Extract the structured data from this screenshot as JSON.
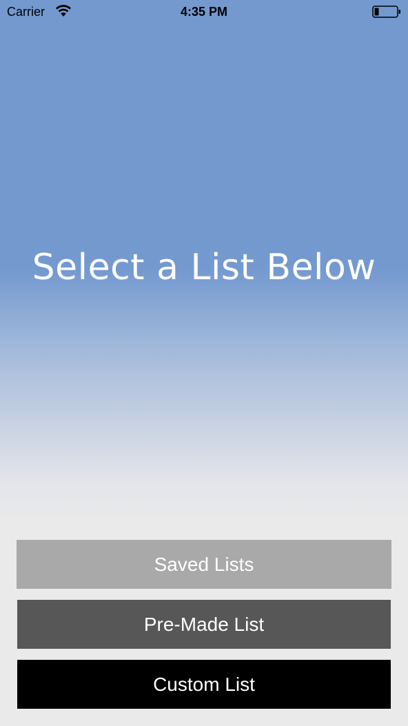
{
  "status_bar": {
    "carrier": "Carrier",
    "time": "4:35 PM",
    "wifi_icon": "wifi-icon",
    "battery_icon": "battery-icon"
  },
  "headline": "Select a List Below",
  "buttons": {
    "saved": "Saved Lists",
    "premade": "Pre-Made List",
    "custom": "Custom List"
  },
  "colors": {
    "background_top": "#7399cf",
    "background_bottom": "#eaeaea",
    "saved_button": "#a9a9a9",
    "premade_button": "#575757",
    "custom_button": "#000000",
    "text": "#ffffff"
  }
}
